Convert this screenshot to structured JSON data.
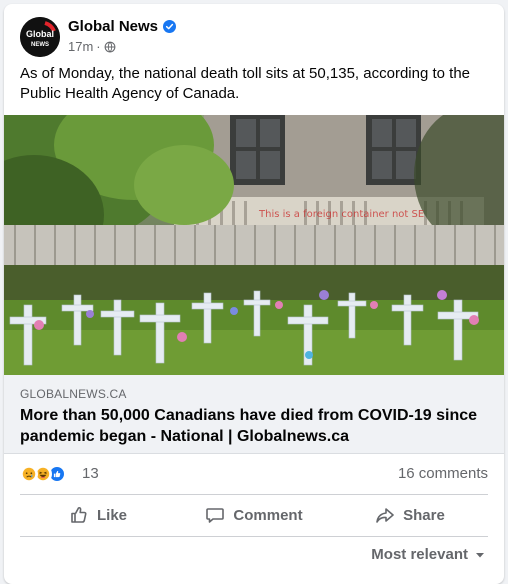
{
  "post": {
    "page_name": "Global News",
    "avatar_text_line1": "Global",
    "avatar_text_line2": "NEWS",
    "time": "17m",
    "dot": "·",
    "text": "As of Monday, the national death toll sits at 50,135, according to the Public Health Agency of Canada.",
    "image_watermark": "This is a foreign container not SE"
  },
  "link": {
    "domain": "GLOBALNEWS.CA",
    "title": "More than 50,000 Canadians have died from COVID-19 since pandemic began - National | Globalnews.ca"
  },
  "reactions": {
    "icons": [
      "sad-icon",
      "haha-icon",
      "like-icon"
    ],
    "count": "13",
    "comments": "16 comments"
  },
  "actions": {
    "like": "Like",
    "comment": "Comment",
    "share": "Share"
  },
  "sort": {
    "label": "Most relevant"
  },
  "colors": {
    "verified": "#1877f2",
    "like_blue": "#1877f2",
    "reaction_yellow": "#f7b125",
    "secondary_text": "#65676b"
  }
}
